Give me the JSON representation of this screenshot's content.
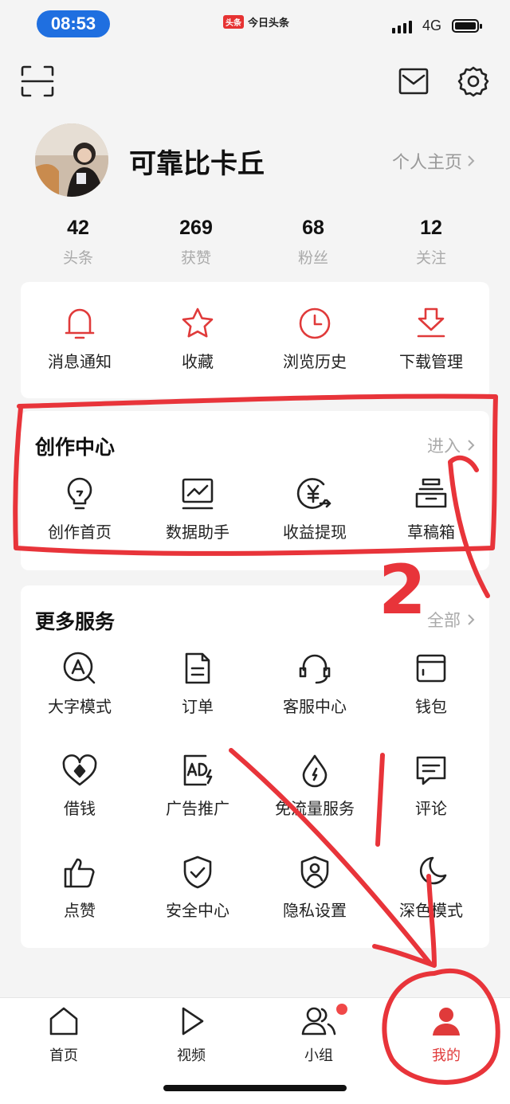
{
  "status": {
    "time": "08:53",
    "app_logo": "头条",
    "app_name": "今日头条",
    "network": "4G"
  },
  "header": {
    "scan_icon": "scan-icon",
    "mail_icon": "mail-icon",
    "settings_icon": "gear-icon"
  },
  "profile": {
    "name": "可靠比卡丘",
    "home_link": "个人主页"
  },
  "stats": [
    {
      "num": "42",
      "label": "头条"
    },
    {
      "num": "269",
      "label": "获赞"
    },
    {
      "num": "68",
      "label": "粉丝"
    },
    {
      "num": "12",
      "label": "关注"
    }
  ],
  "quick": [
    {
      "label": "消息通知",
      "icon": "bell-icon"
    },
    {
      "label": "收藏",
      "icon": "star-icon"
    },
    {
      "label": "浏览历史",
      "icon": "clock-icon"
    },
    {
      "label": "下载管理",
      "icon": "download-icon"
    }
  ],
  "creator": {
    "title": "创作中心",
    "more": "进入",
    "items": [
      {
        "label": "创作首页",
        "icon": "lightbulb-icon"
      },
      {
        "label": "数据助手",
        "icon": "chart-icon"
      },
      {
        "label": "收益提现",
        "icon": "yen-icon"
      },
      {
        "label": "草稿箱",
        "icon": "drafts-icon"
      }
    ]
  },
  "services": {
    "title": "更多服务",
    "more": "全部",
    "items": [
      {
        "label": "大字模式",
        "icon": "large-font-icon"
      },
      {
        "label": "订单",
        "icon": "order-icon"
      },
      {
        "label": "客服中心",
        "icon": "headset-icon"
      },
      {
        "label": "钱包",
        "icon": "wallet-icon"
      },
      {
        "label": "借钱",
        "icon": "loan-icon"
      },
      {
        "label": "广告推广",
        "icon": "ad-icon"
      },
      {
        "label": "免流量服务",
        "icon": "data-free-icon"
      },
      {
        "label": "评论",
        "icon": "comment-icon"
      },
      {
        "label": "点赞",
        "icon": "thumbs-up-icon"
      },
      {
        "label": "安全中心",
        "icon": "shield-icon"
      },
      {
        "label": "隐私设置",
        "icon": "privacy-icon"
      },
      {
        "label": "深色模式",
        "icon": "moon-icon"
      }
    ]
  },
  "tabs": [
    {
      "label": "首页",
      "icon": "home-icon"
    },
    {
      "label": "视频",
      "icon": "play-icon"
    },
    {
      "label": "小组",
      "icon": "group-icon"
    },
    {
      "label": "我的",
      "icon": "person-icon",
      "active": true
    }
  ],
  "annotation": {
    "number": "2"
  },
  "colors": {
    "accent": "#e03a3a",
    "status_pill": "#1f6fe0",
    "annotation": "#e8343a"
  }
}
